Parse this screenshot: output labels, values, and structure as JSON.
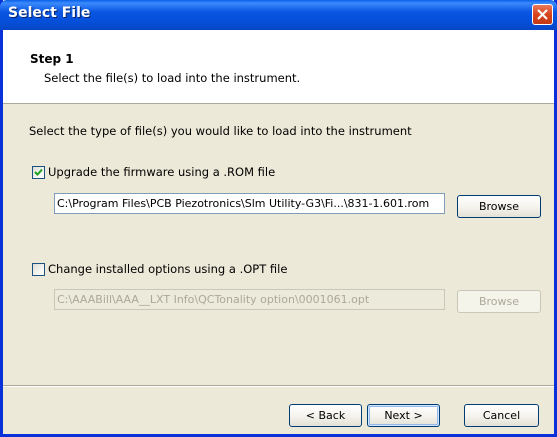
{
  "window": {
    "title": "Select File",
    "accent_color": "#0a56e2",
    "close_icon": "close-icon"
  },
  "header": {
    "step_title": "Step 1",
    "step_description": "Select the file(s) to load into the instrument."
  },
  "main": {
    "instruction": "Select the type of file(s) you would like to load into the instrument",
    "firmware": {
      "checked": true,
      "label": "Upgrade the firmware using a .ROM file",
      "path": "C:\\Program Files\\PCB Piezotronics\\Slm Utility-G3\\Fi...\\831-1.601.rom",
      "browse_label": "Browse",
      "enabled": true
    },
    "options": {
      "checked": false,
      "label": "Change installed options using a .OPT file",
      "path": "C:\\AAABill\\AAA__LXT Info\\QCTonality option\\0001061.opt",
      "browse_label": "Browse",
      "enabled": false
    }
  },
  "footer": {
    "back_label": "< Back",
    "next_label": "Next >",
    "cancel_label": "Cancel"
  }
}
